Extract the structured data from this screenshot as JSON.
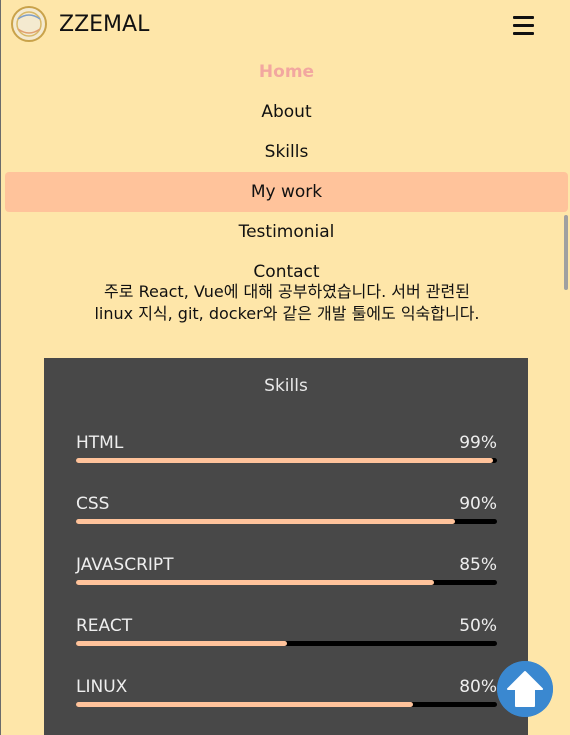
{
  "header": {
    "brand": "ZZEMAL",
    "logo_icon": "logo-icon",
    "menu_icon": "hamburger-menu-icon"
  },
  "nav": {
    "items": [
      {
        "label": "Home"
      },
      {
        "label": "About"
      },
      {
        "label": "Skills"
      },
      {
        "label": "My work"
      },
      {
        "label": "Testimonial"
      },
      {
        "label": "Contact"
      }
    ]
  },
  "intro": {
    "line1": "주로 React, Vue에 대해 공부하였습니다. 서버 관련된",
    "line2": "linux 지식, git, docker와 같은 개발 툴에도 익숙합니다."
  },
  "skills": {
    "title": "Skills",
    "items": [
      {
        "name": "HTML",
        "percent": "99%",
        "level": 99
      },
      {
        "name": "CSS",
        "percent": "90%",
        "level": 90
      },
      {
        "name": "JAVASCRIPT",
        "percent": "85%",
        "level": 85
      },
      {
        "name": "REACT",
        "percent": "50%",
        "level": 50
      },
      {
        "name": "LINUX",
        "percent": "80%",
        "level": 80
      }
    ]
  },
  "colors": {
    "page_bg": "#fee6a9",
    "accent": "#ffc39b",
    "home_active": "#f2a7a0",
    "panel_bg": "#484848",
    "to_top": "#3a88d0"
  },
  "to_top_icon": "arrow-up-icon"
}
